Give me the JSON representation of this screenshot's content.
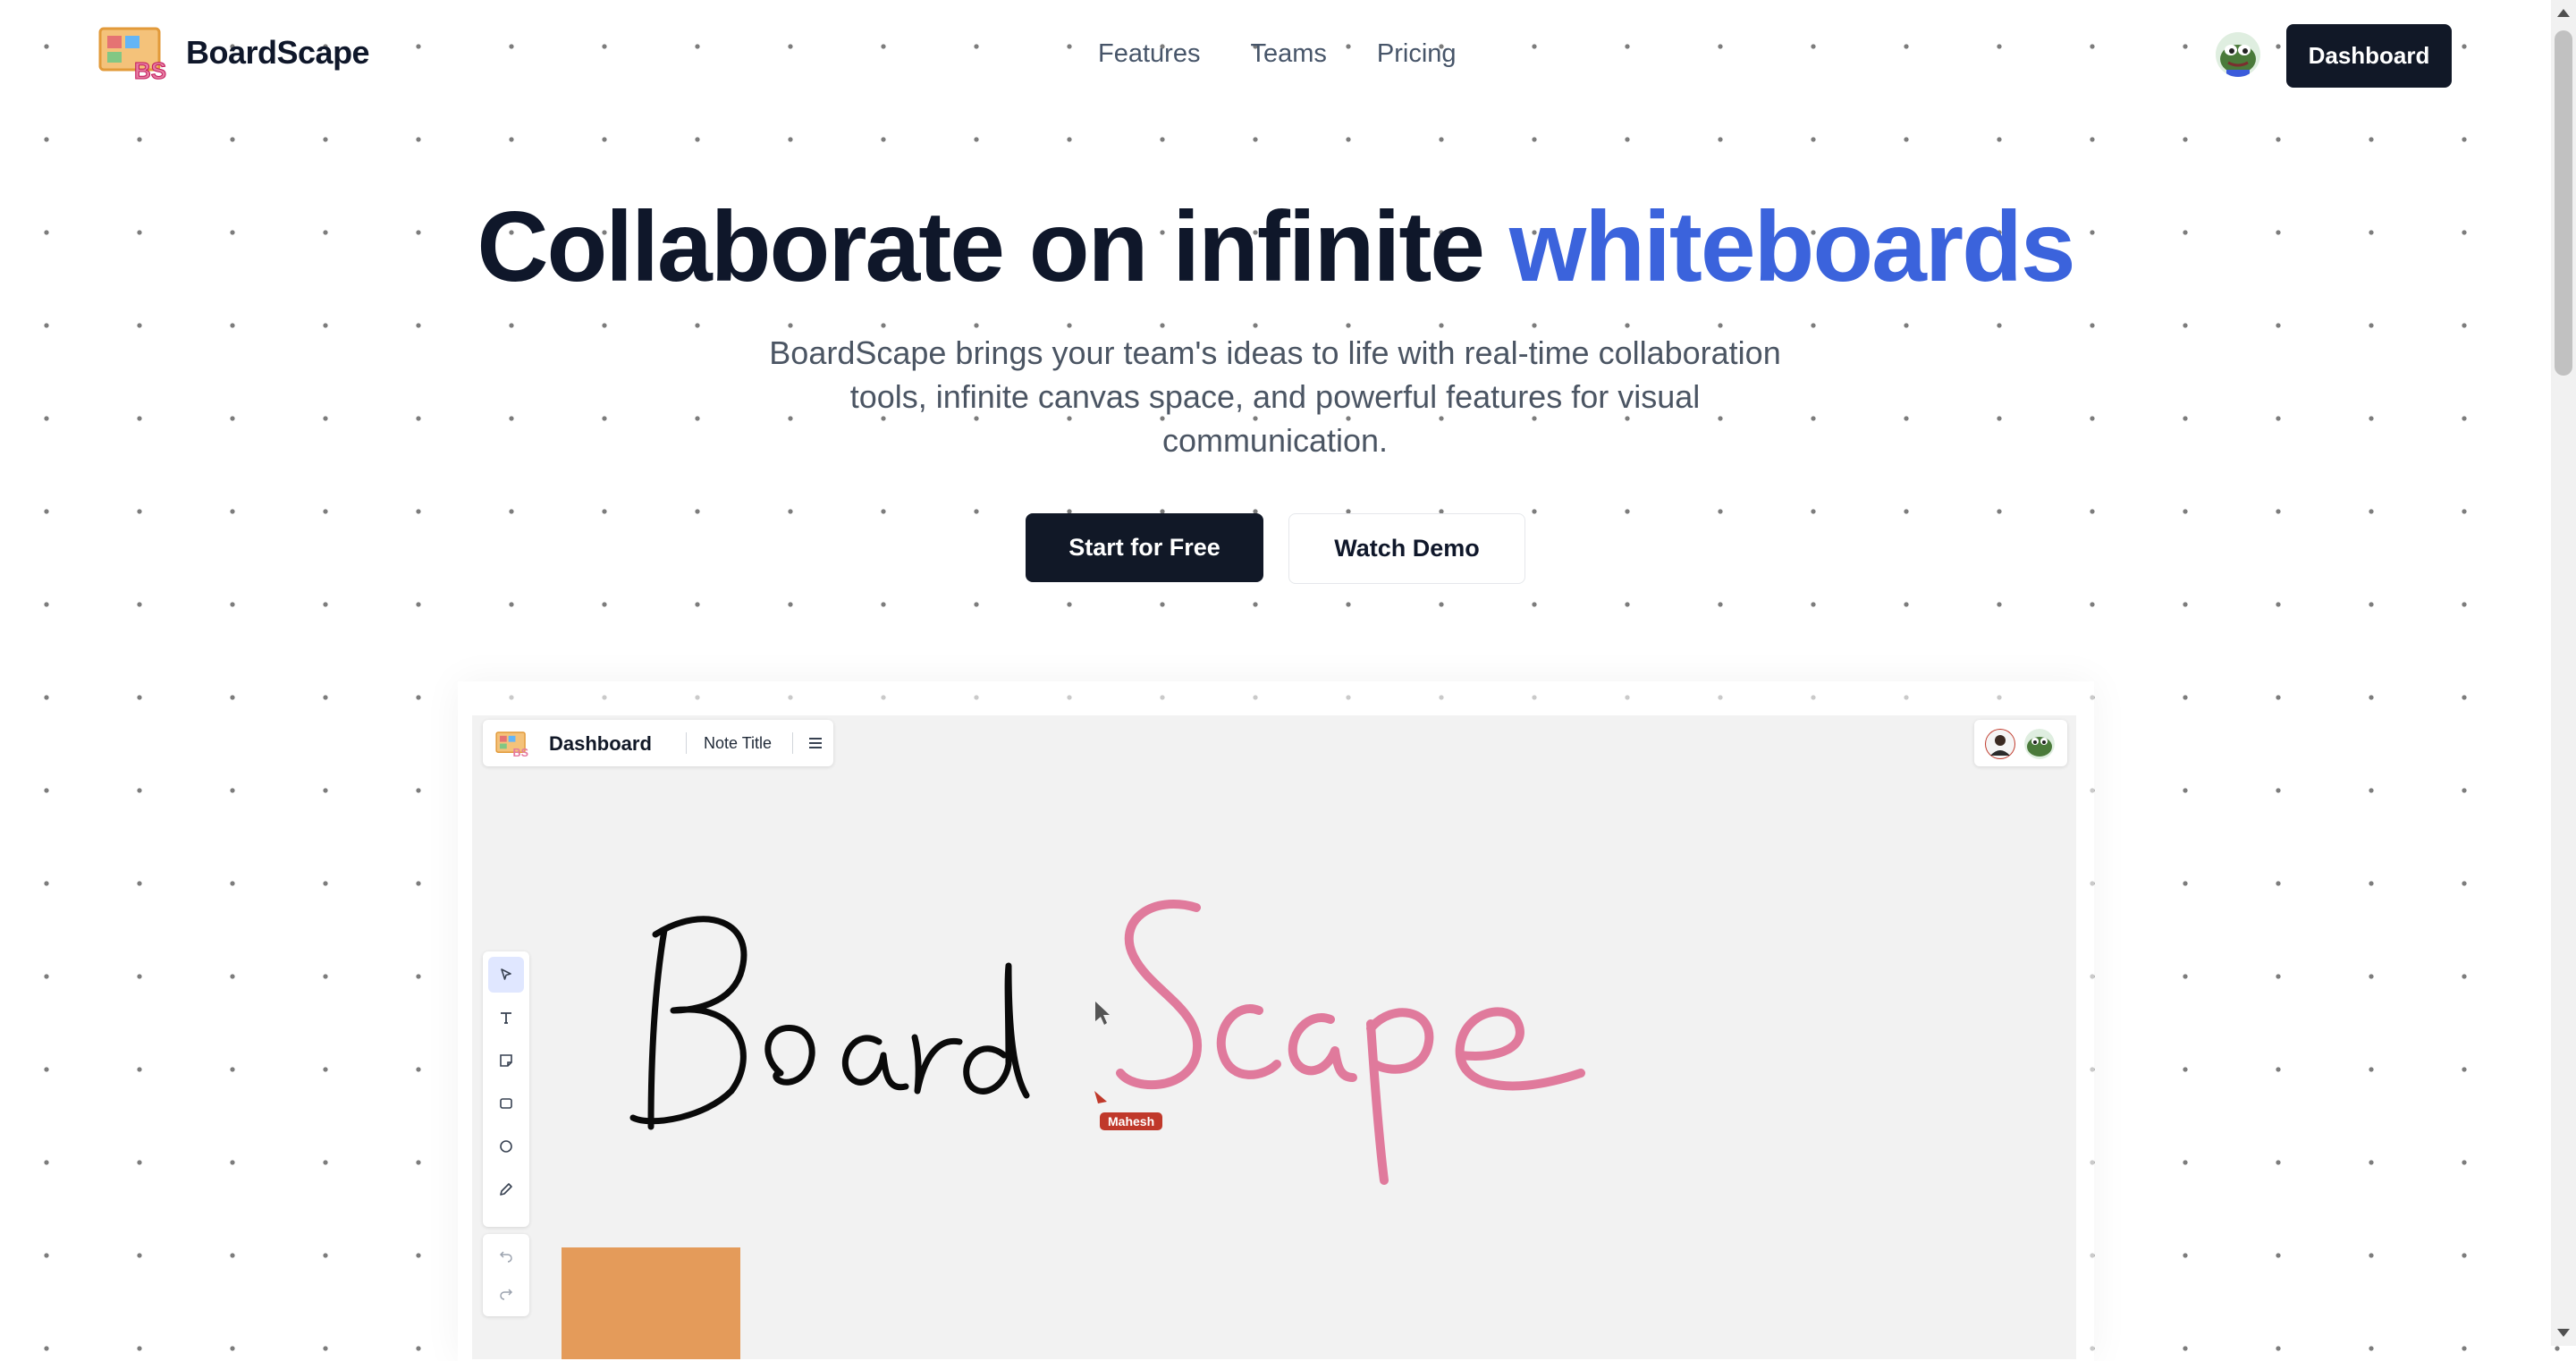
{
  "header": {
    "brand": "BoardScape",
    "nav": [
      "Features",
      "Teams",
      "Pricing"
    ],
    "dashboard_label": "Dashboard"
  },
  "hero": {
    "title_main": "Collaborate on infinite ",
    "title_accent": "whiteboards",
    "subtitle": "BoardScape brings your team's ideas to life with real-time collaboration tools, infinite canvas space, and powerful features for visual communication.",
    "cta_primary": "Start for Free",
    "cta_secondary": "Watch Demo"
  },
  "preview": {
    "title": "Dashboard",
    "note_title": "Note Title",
    "cursor_user": "Mahesh",
    "tools": [
      "select-icon",
      "text-icon",
      "sticky-note-icon",
      "rectangle-icon",
      "circle-icon",
      "pencil-icon",
      "undo-icon",
      "redo-icon"
    ],
    "sticky_note_text": "",
    "ink_colors": {
      "black_word": "#0a0a0a",
      "pink_word": "#e07a9c"
    }
  },
  "colors": {
    "accent": "#3b63dc",
    "primary_button": "#111827",
    "sticky": "#e49b5a",
    "cursor": "#c0392b"
  }
}
